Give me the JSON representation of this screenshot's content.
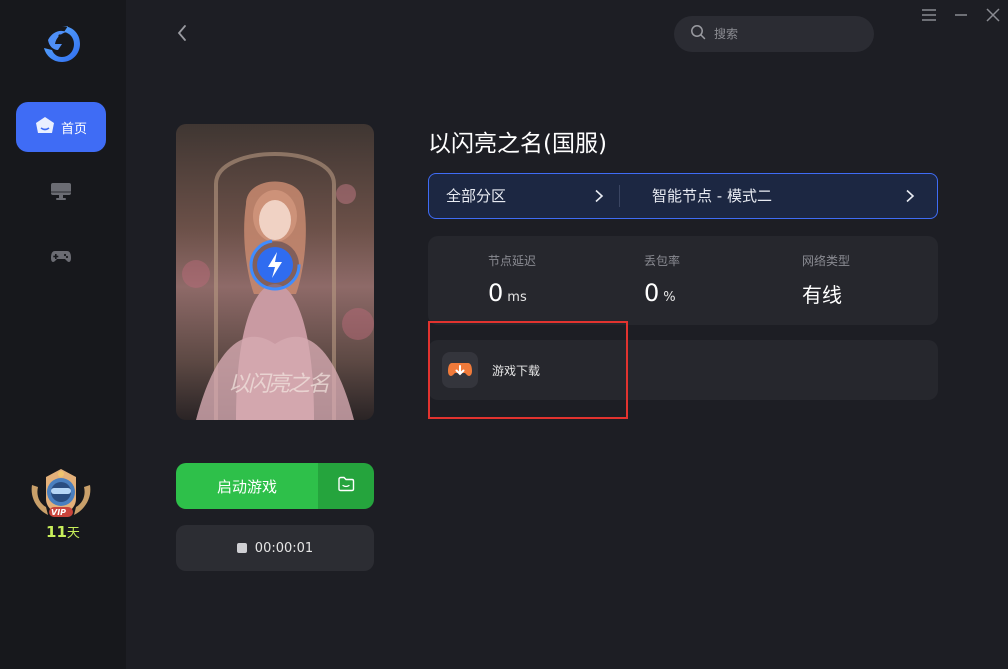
{
  "window": {
    "controls": {
      "menu_icon": "menu-icon",
      "minimize_icon": "minimize-icon",
      "close_icon": "close-icon"
    }
  },
  "sidebar": {
    "logo_icon": "dolphin-logo-icon",
    "items": [
      {
        "label": "首页",
        "icon": "home-icon",
        "active": true
      },
      {
        "label": "",
        "icon": "monitor-icon",
        "active": false
      },
      {
        "label": "",
        "icon": "gamepad-icon",
        "active": false
      }
    ],
    "vip": {
      "badge_text": "VIP",
      "days": "11",
      "days_unit": "天"
    }
  },
  "header": {
    "back_icon": "back-chevron-icon",
    "search": {
      "placeholder": "搜索",
      "value": ""
    }
  },
  "game": {
    "title": "以闪亮之名(国服)",
    "poster_title": "以闪亮之名",
    "region": {
      "label": "全部分区"
    },
    "node": {
      "label": "智能节点 - 模式二"
    },
    "stats": [
      {
        "label": "节点延迟",
        "value": "0",
        "unit": "ms"
      },
      {
        "label": "丢包率",
        "value": "0",
        "unit": "%"
      },
      {
        "label": "网络类型",
        "value": "有线",
        "unit": ""
      }
    ],
    "download": {
      "label": "游戏下载"
    },
    "launch_button": "启动游戏",
    "timer": "00:00:01"
  },
  "colors": {
    "accent": "#3f6cf5",
    "launch_green": "#2ec04a",
    "highlight_red": "#e2332f",
    "vip_days": "#c8ef5a"
  }
}
